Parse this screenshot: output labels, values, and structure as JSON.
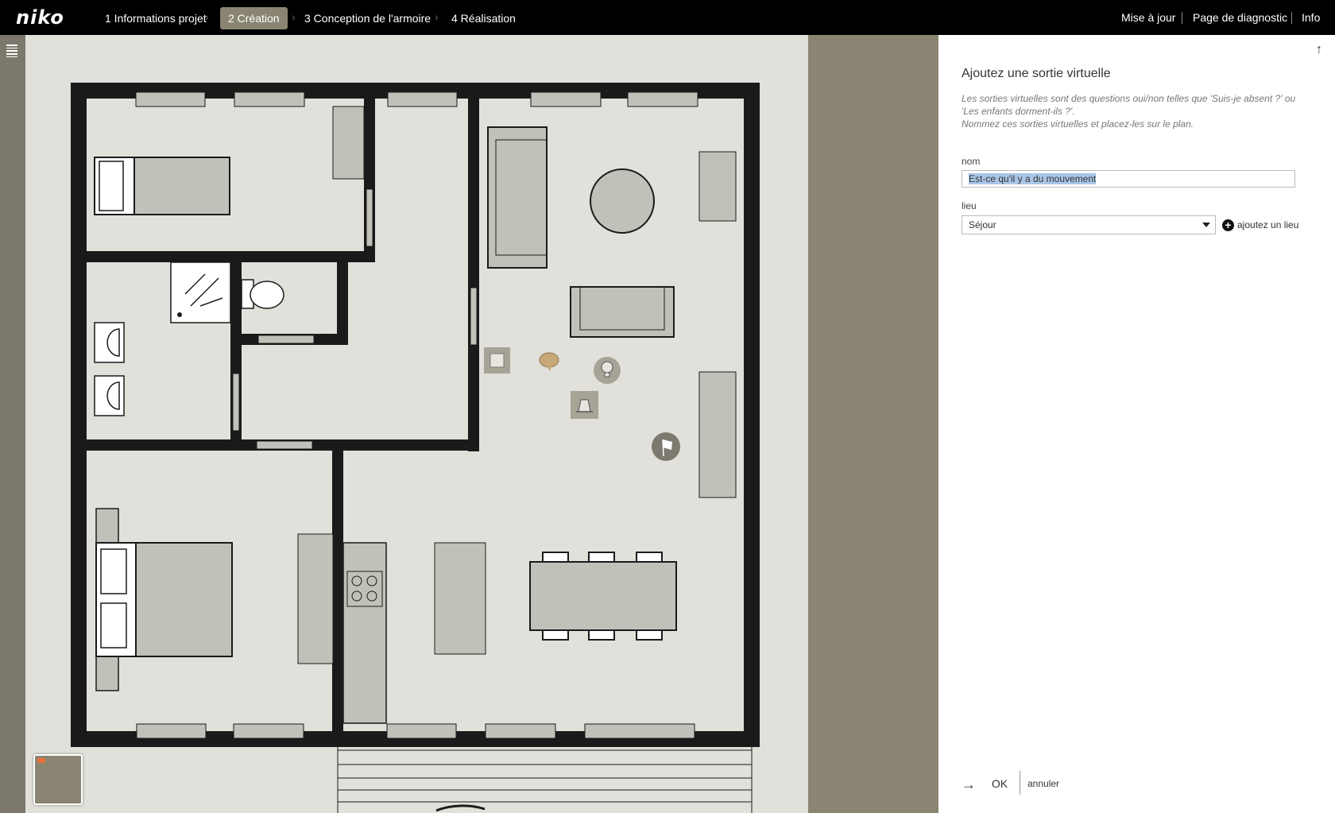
{
  "header": {
    "logo": "niko",
    "steps": [
      {
        "label": "1 Informations projet",
        "active": false
      },
      {
        "label": "2 Création",
        "active": true
      },
      {
        "label": "3 Conception de l'armoire",
        "active": false
      },
      {
        "label": "4 Réalisation",
        "active": false
      }
    ],
    "nav": [
      "Mise à jour",
      "Page de diagnostic",
      "Info"
    ]
  },
  "sidebar": {
    "menu_icon": "list-icon"
  },
  "canvas": {
    "icons": [
      "square-switch-icon",
      "speech-bubble-icon",
      "lightbulb-icon",
      "motion-sensor-icon",
      "flag-icon"
    ],
    "colors": {
      "wall": "#1a1a1a",
      "floor": "#e1e0da",
      "furniture": "#c2c1b9",
      "accent_bubble": "#c9a878"
    }
  },
  "panel": {
    "title": "Ajoutez une sortie virtuelle",
    "description_line1": "Les sorties virtuelles sont des questions oui/non telles que 'Suis-je absent ?' ou 'Les enfants dorment-ils ?'.",
    "description_line2": "Nommez ces sorties virtuelles et placez-les sur le plan.",
    "name_label": "nom",
    "name_value": "Est-ce qu'il y a du mouvement",
    "location_label": "lieu",
    "location_value": "Séjour",
    "add_location": "ajoutez un lieu",
    "ok": "OK",
    "cancel": "annuler"
  }
}
